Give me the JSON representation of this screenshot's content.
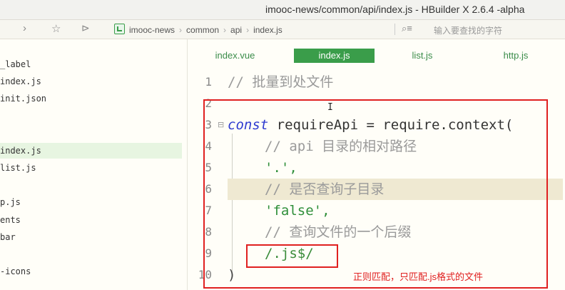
{
  "window": {
    "title": "imooc-news/common/api/index.js - HBuilder X 2.6.4 -alpha"
  },
  "toolbar": {
    "back_icon": "chevron-right-icon",
    "star_icon": "star-icon",
    "run_icon": "play-icon",
    "breadcrumb": [
      "imooc-news",
      "common",
      "api",
      "index.js"
    ],
    "search_placeholder": "输入要查找的字符"
  },
  "sidebar": {
    "items": [
      {
        "label": "_label",
        "active": false
      },
      {
        "label": "index.js",
        "active": false
      },
      {
        "label": "init.json",
        "active": false
      },
      {
        "label": "index.js",
        "active": true
      },
      {
        "label": "list.js",
        "active": false
      },
      {
        "label": "p.js",
        "active": false
      },
      {
        "label": "ents",
        "active": false
      },
      {
        "label": "bar",
        "active": false
      },
      {
        "label": "-icons",
        "active": false
      }
    ]
  },
  "tabs": [
    {
      "label": "index.vue",
      "active": false
    },
    {
      "label": "index.js",
      "active": true
    },
    {
      "label": "list.js",
      "active": false
    },
    {
      "label": "http.js",
      "active": false
    }
  ],
  "editor": {
    "lines": [
      {
        "n": "1",
        "text": "// 批量到处文件"
      },
      {
        "n": "2",
        "text": ""
      },
      {
        "n": "3",
        "kw": "const",
        "text": " requireApi = require.context("
      },
      {
        "n": "4",
        "text": "// api 目录的相对路径"
      },
      {
        "n": "5",
        "text": "'.',"
      },
      {
        "n": "6",
        "text": "// 是否查询子目录"
      },
      {
        "n": "7",
        "text": "'false',"
      },
      {
        "n": "8",
        "text": "// 查询文件的一个后缀"
      },
      {
        "n": "9",
        "text": "/.js$/"
      },
      {
        "n": "10",
        "text": ")"
      }
    ],
    "annotation": "正则匹配，只匹配.js格式的文件",
    "cursor": "I"
  },
  "colors": {
    "accent": "#3a9d4a",
    "annotation_red": "#e02020",
    "keyword": "#2e3bd0",
    "string": "#2f8f3a"
  }
}
